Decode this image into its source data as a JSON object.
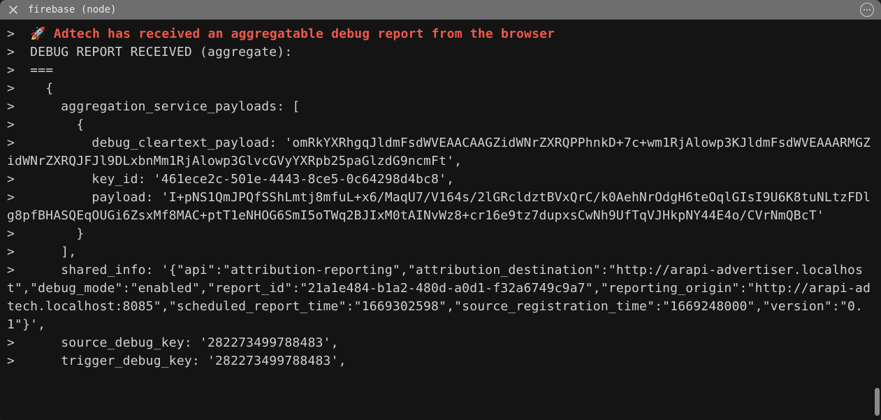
{
  "title_bar": {
    "title": "firebase (node)"
  },
  "terminal": {
    "prompt": ">",
    "rocket_emoji": "🚀",
    "header_line": "Adtech has received an aggregatable debug report from the browser",
    "lines": [
      {
        "prompt": true,
        "text": "DEBUG REPORT RECEIVED (aggregate):"
      },
      {
        "prompt": true,
        "text": "==="
      },
      {
        "prompt": true,
        "text": "  {"
      },
      {
        "prompt": true,
        "text": "    aggregation_service_payloads: ["
      },
      {
        "prompt": true,
        "text": "      {"
      },
      {
        "prompt": true,
        "text": "        debug_cleartext_payload: 'omRkYXRhgqJldmFsdWVEAACAAGZidWNrZXRQPPhnkD+7c+wm1RjAlowp3KJldmFsdWVEAAARMGZidWNrZXRQJFJl9DLxbnMm1RjAlowp3GlvcGVyYXRpb25paGlzdG9ncmFt',"
      },
      {
        "prompt": true,
        "text": "        key_id: '461ece2c-501e-4443-8ce5-0c64298d4bc8',"
      },
      {
        "prompt": true,
        "text": "        payload: 'I+pNS1QmJPQfSShLmtj8mfuL+x6/MaqU7/V164s/2lGRcldztBVxQrC/k0AehNrOdgH6teOqlGIsI9U6K8tuNLtzFDlg8pfBHASQEqOUGi6ZsxMf8MAC+ptT1eNHOG6SmI5oTWq2BJIxM0tAINvWz8+cr16e9tz7dupxsCwNh9UfTqVJHkpNY44E4o/CVrNmQBcT'"
      },
      {
        "prompt": true,
        "text": "      }"
      },
      {
        "prompt": true,
        "text": "    ],"
      },
      {
        "prompt": true,
        "text": "    shared_info: '{\"api\":\"attribution-reporting\",\"attribution_destination\":\"http://arapi-advertiser.localhost\",\"debug_mode\":\"enabled\",\"report_id\":\"21a1e484-b1a2-480d-a0d1-f32a6749c9a7\",\"reporting_origin\":\"http://arapi-adtech.localhost:8085\",\"scheduled_report_time\":\"1669302598\",\"source_registration_time\":\"1669248000\",\"version\":\"0.1\"}',"
      },
      {
        "prompt": true,
        "text": "    source_debug_key: '282273499788483',"
      },
      {
        "prompt": true,
        "text": "    trigger_debug_key: '282273499788483',"
      }
    ]
  }
}
